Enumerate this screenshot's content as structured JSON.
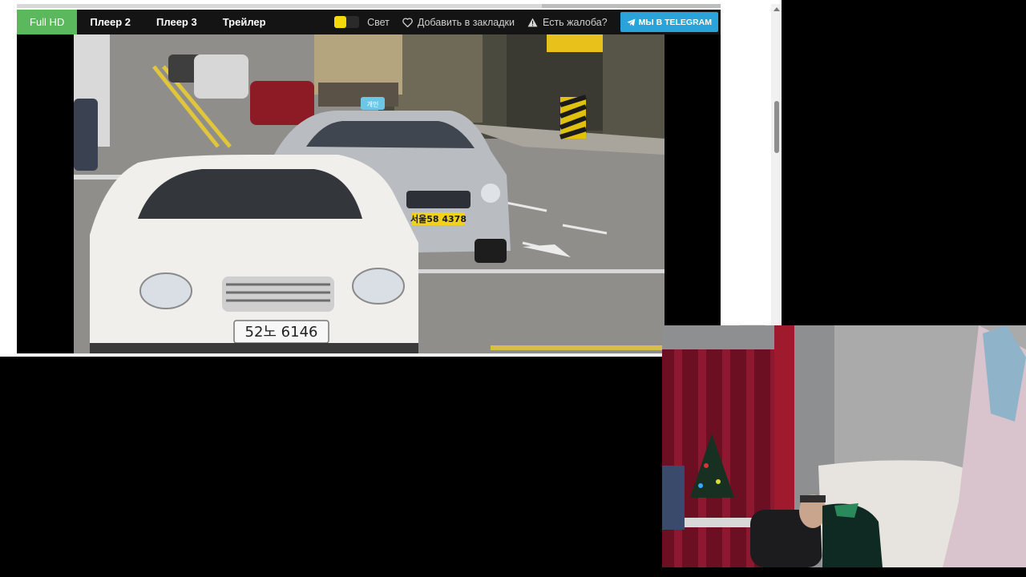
{
  "player": {
    "tabs": [
      {
        "label": "Full HD",
        "active": true
      },
      {
        "label": "Плеер 2",
        "active": false
      },
      {
        "label": "Плеер 3",
        "active": false
      },
      {
        "label": "Трейлер",
        "active": false
      }
    ],
    "light_label": "Свет",
    "bookmark_label": "Добавить в закладки",
    "complaint_label": "Есть жалоба?",
    "telegram_label": "МЫ В TELEGRAM"
  },
  "video": {
    "plate_front": "52노 6146",
    "plate_taxi": "서울58 4378",
    "taxi_sign": "개인"
  },
  "icons": [
    "heart-icon",
    "warning-icon",
    "telegram-icon",
    "arrow-up-icon"
  ],
  "colors": {
    "active_tab": "#5cb85c",
    "toolbar": "#141414",
    "telegram": "#2aa3db",
    "light_knob": "#f5d90a"
  }
}
